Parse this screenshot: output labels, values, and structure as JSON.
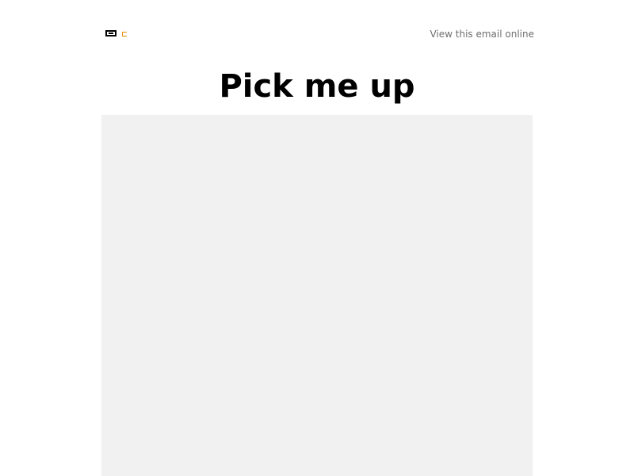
{
  "header": {
    "view_online_link": "View this email online"
  },
  "main": {
    "title": "Pick me up"
  },
  "colors": {
    "background": "#ffffff",
    "hero_placeholder": "#f1f1f1",
    "link_text": "#6e6e6e",
    "logo_accent": "#e08a00"
  }
}
